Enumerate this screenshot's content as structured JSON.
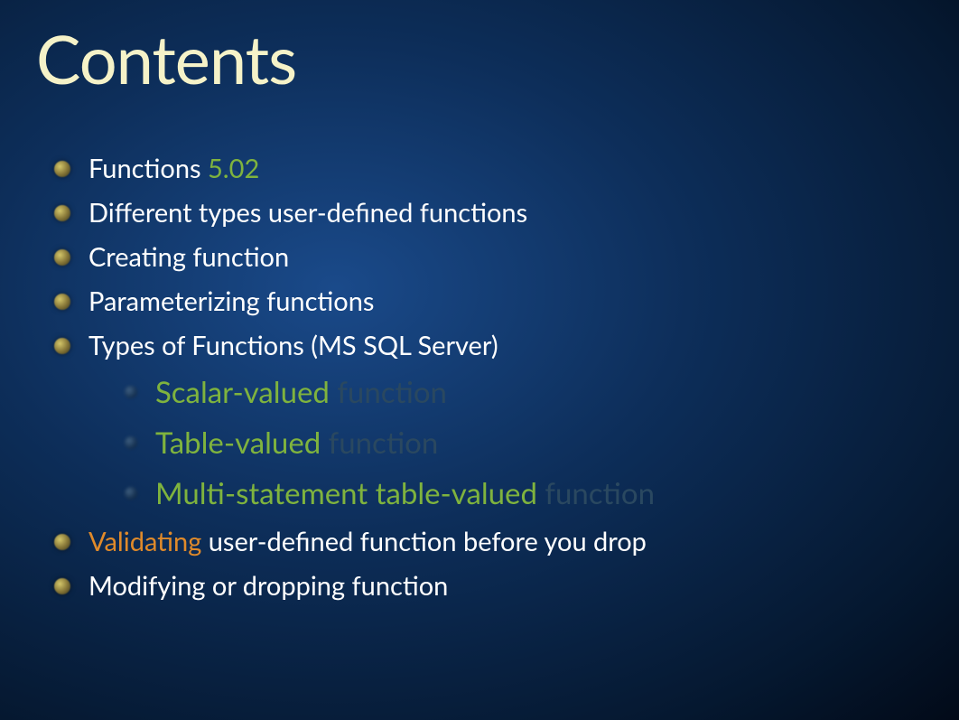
{
  "title": "Contents",
  "items": [
    {
      "parts": [
        {
          "text": "Functions ",
          "color": "white"
        },
        {
          "text": "5.02",
          "color": "green"
        }
      ]
    },
    {
      "parts": [
        {
          "text": "Different types user-defined functions",
          "color": "white"
        }
      ]
    },
    {
      "parts": [
        {
          "text": "Creating function",
          "color": "white"
        }
      ]
    },
    {
      "parts": [
        {
          "text": "Parameterizing functions",
          "color": "white"
        }
      ]
    },
    {
      "parts": [
        {
          "text": "Types of Functions (MS SQL Server)",
          "color": "white"
        }
      ],
      "sub": [
        {
          "parts": [
            {
              "text": "Scalar-valued",
              "color": "green"
            },
            {
              "text": " function",
              "color": "dim-blue"
            }
          ]
        },
        {
          "parts": [
            {
              "text": "Table-valued",
              "color": "green"
            },
            {
              "text": " function",
              "color": "dim-blue"
            }
          ]
        },
        {
          "parts": [
            {
              "text": "Multi-statement table-valued",
              "color": "green"
            },
            {
              "text": " function",
              "color": "dim-blue"
            }
          ]
        }
      ]
    },
    {
      "parts": [
        {
          "text": "Validating",
          "color": "orange"
        },
        {
          "text": " user-defined function before you drop",
          "color": "white"
        }
      ]
    },
    {
      "parts": [
        {
          "text": "Modifying or dropping function",
          "color": "white"
        }
      ]
    }
  ]
}
